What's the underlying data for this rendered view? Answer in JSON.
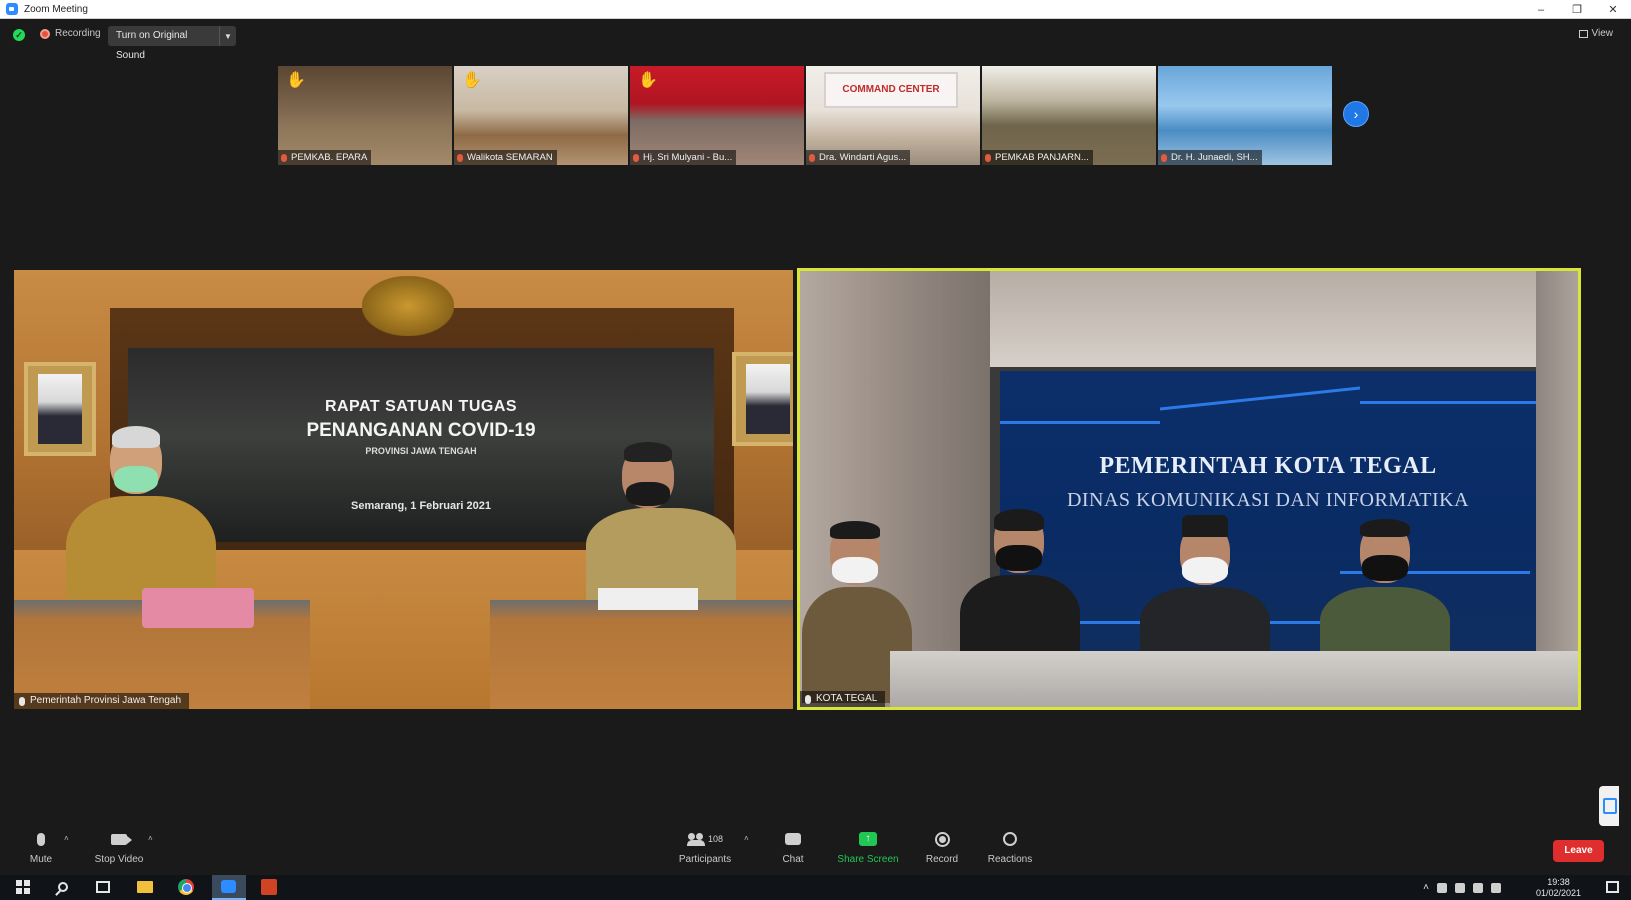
{
  "window": {
    "title": "Zoom Meeting",
    "controls": [
      "–",
      "❐",
      "✕"
    ]
  },
  "topbar": {
    "recording_label": "Recording",
    "original_sound_label": "Turn on Original Sound",
    "view_label": "View"
  },
  "thumbnails": [
    {
      "name": "PEMKAB. EPARA"
    },
    {
      "name": "Walikota SEMARAN"
    },
    {
      "name": "Hj. Sri Mulyani - Bu..."
    },
    {
      "name": "Dra. Windarti Agus..."
    },
    {
      "name": "PEMKAB PANJARN..."
    },
    {
      "name": "Dr. H. Junaedi, SH..."
    }
  ],
  "thumbnail_sign": "COMMAND CENTER",
  "main_left": {
    "participant_name": "Pemerintah Provinsi Jawa Tengah",
    "screen_line1": "RAPAT SATUAN TUGAS",
    "screen_line2": "PENANGANAN COVID-19",
    "screen_line3": "PROVINSI JAWA TENGAH",
    "screen_line4": "Semarang, 1 Februari 2021"
  },
  "main_right": {
    "participant_name": "KOTA TEGAL",
    "wall_line1": "PEMERINTAH KOTA TEGAL",
    "wall_line2": "DINAS KOMUNIKASI DAN INFORMATIKA"
  },
  "toolbar": {
    "mute_label": "Mute",
    "stop_video_label": "Stop Video",
    "participants_label": "Participants",
    "participants_count": "108",
    "chat_label": "Chat",
    "share_screen_label": "Share Screen",
    "record_label": "Record",
    "reactions_label": "Reactions",
    "leave_label": "Leave"
  },
  "taskbar": {
    "time": "19:38",
    "date": "01/02/2021"
  },
  "colors": {
    "active_speaker_border": "#d9e638",
    "share_green": "#22c655",
    "leave_red": "#e02d2d",
    "zoom_blue": "#2d8cff"
  }
}
